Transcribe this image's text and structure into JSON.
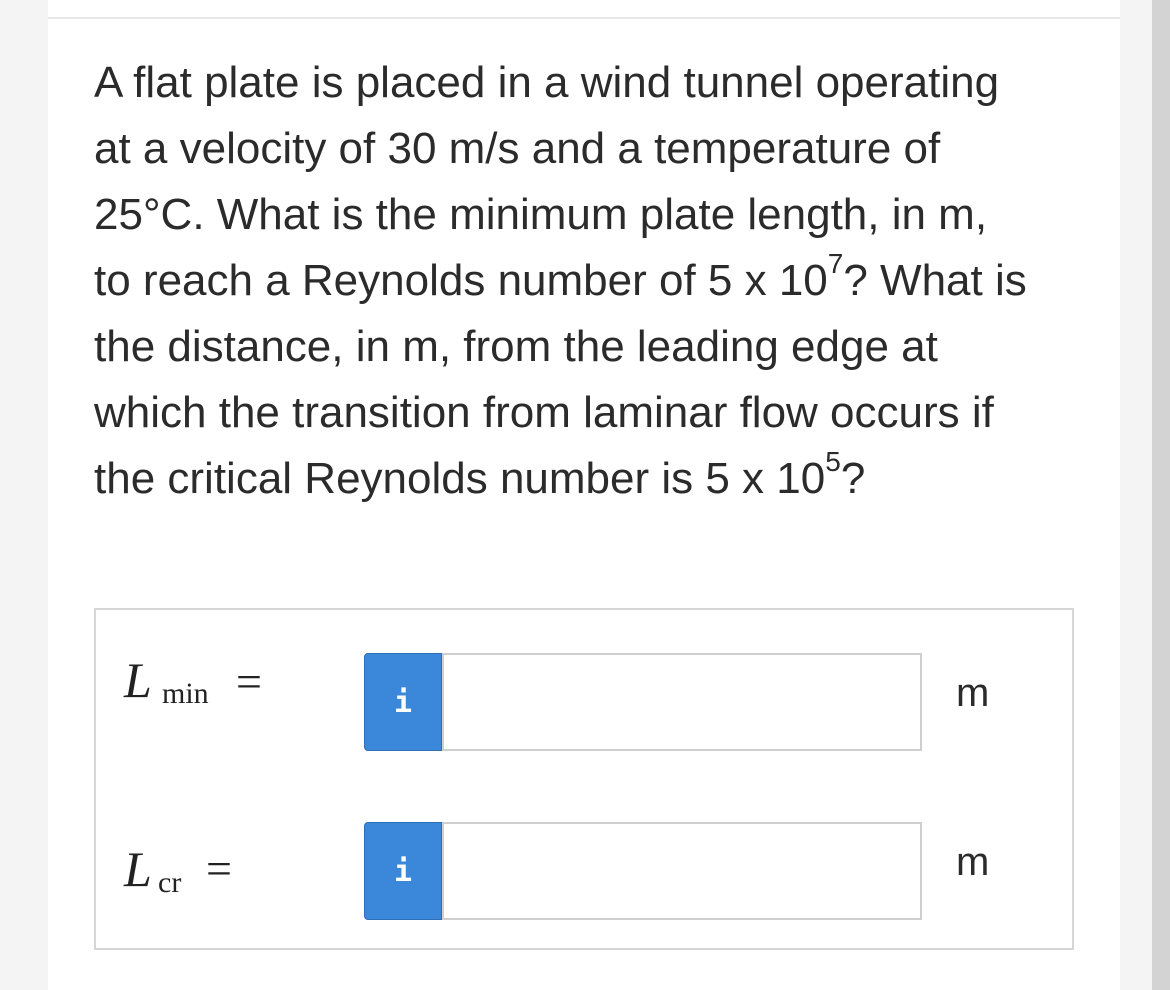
{
  "question": {
    "lines": [
      "A flat plate is placed in a wind tunnel operating",
      "at a velocity of 30 m/s and a temperature of",
      "25°C. What is the minimum plate length, in m,"
    ],
    "line4_before": "to reach a Reynolds number of 5 x 10",
    "line4_exp": "7",
    "line4_after": "? What is",
    "line5": "the distance, in m, from the leading edge at",
    "line6": "which the transition from laminar flow occurs if",
    "line7_before": "the critical Reynolds number is 5 x 10",
    "line7_exp": "5",
    "line7_after": "?"
  },
  "answers": [
    {
      "var": "L",
      "sub": "min",
      "equals": "=",
      "info_icon": "i",
      "value": "",
      "unit": "m"
    },
    {
      "var": "L",
      "sub": "cr",
      "equals": "=",
      "info_icon": "i",
      "value": "",
      "unit": "m"
    }
  ],
  "colors": {
    "info_button": "#3b87d9",
    "text": "#2b2b2b",
    "border": "#d6d6d6"
  }
}
